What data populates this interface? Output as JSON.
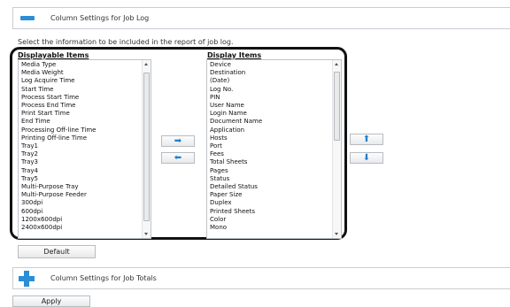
{
  "job_log_section": {
    "title": "Column Settings for Job Log"
  },
  "intro_text": "Select the information to be included in the report of job log.",
  "displayable": {
    "title": "Displayable Items",
    "items": [
      "Media Type",
      "Media Weight",
      "Log Acquire Time",
      "Start Time",
      "Process Start Time",
      "Process End Time",
      "Print Start Time",
      "End Time",
      "Processing Off-line Time",
      "Printing Off-line Time",
      "Tray1",
      "Tray2",
      "Tray3",
      "Tray4",
      "Tray5",
      "Multi-Purpose Tray",
      "Multi-Purpose Feeder",
      "300dpi",
      "600dpi",
      "1200x600dpi",
      "2400x600dpi"
    ]
  },
  "display": {
    "title": "Display Items",
    "items": [
      "Device",
      "Destination",
      "(Date)",
      "Log No.",
      "PIN",
      "User Name",
      "Login Name",
      "Document Name",
      "Application",
      "Hosts",
      "Port",
      "Fees",
      "Total Sheets",
      "Pages",
      "Status",
      "Detailed Status",
      "Paper Size",
      "Duplex",
      "Printed Sheets",
      "Color",
      "Mono"
    ]
  },
  "buttons": {
    "add_glyph": "➡",
    "remove_glyph": "⬅",
    "move_up_glyph": "⬆",
    "move_down_glyph": "⬇",
    "default_label": "Default",
    "apply_label": "Apply"
  },
  "job_totals_section": {
    "title": "Column Settings for Job Totals"
  },
  "colors": {
    "accent": "#2b8ed6",
    "highlight_border": "#111111"
  }
}
